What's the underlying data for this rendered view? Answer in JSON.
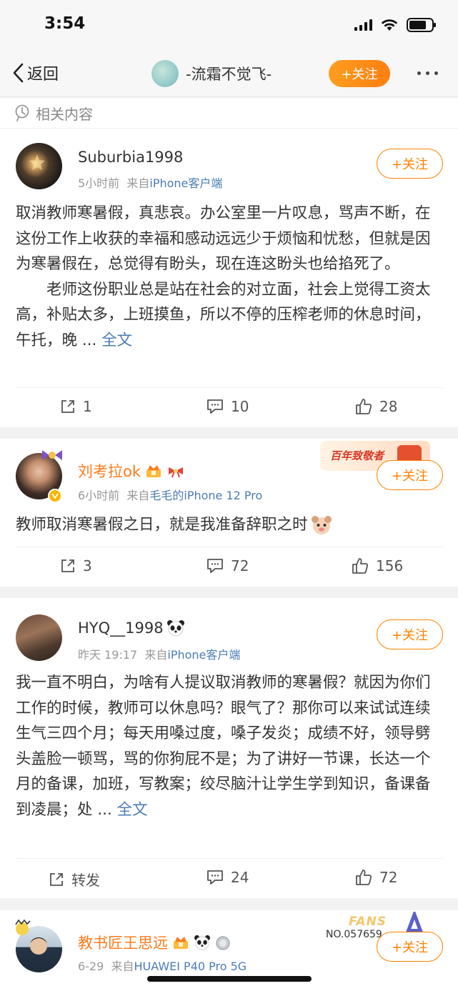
{
  "status": {
    "time": "3:54"
  },
  "nav": {
    "back_label": "返回",
    "title": "-流霜不觉飞-",
    "follow_label": "+关注"
  },
  "related": {
    "label": "相关内容"
  },
  "posts": [
    {
      "username": "Suburbia1998",
      "time": "5小时前",
      "from_label": "来自",
      "source": "iPhone客户端",
      "follow_label": "+关注",
      "content": "取消教师寒暑假，真悲哀。办公室里一片叹息，骂声不断，在这份工作上收获的幸福和感动远远少于烦恼和忧愁，但就是因为寒暑假在，总觉得有盼头，现在连这盼头也给掐死了。\n　　老师这份职业总是站在社会的对立面，社会上觉得工资太高，补贴太多，上班摸鱼，所以不停的压榨老师的休息时间，午托，晚 ... ",
      "more_label": "全文",
      "reposts": "1",
      "comments": "10",
      "likes": "28"
    },
    {
      "username": "刘考拉ok",
      "time": "6小时前",
      "from_label": "来自",
      "source": "毛毛的iPhone 12 Pro",
      "follow_label": "+关注",
      "banner_text": "百年致敬者",
      "content": "教师取消寒暑假之日，就是我准备辞职之时",
      "reposts": "3",
      "comments": "72",
      "likes": "156"
    },
    {
      "username": "HYQ__1998",
      "time": "昨天 19:17",
      "from_label": "来自",
      "source": "iPhone客户端",
      "follow_label": "+关注",
      "content": "我一直不明白，为啥有人提议取消教师的寒暑假？就因为你们工作的时候，教师可以休息吗？眼气了？那你可以来试试连续生气三四个月；每天用嗓过度，嗓子发炎；成绩不好，领导劈头盖脸一顿骂，骂的你狗屁不是；为了讲好一节课，长达一个月的备课，加班，写教案；绞尽脑汁让学生学到知识，备课备到凌晨；处 ... ",
      "more_label": "全文",
      "repost_label": "转发",
      "comments": "24",
      "likes": "72"
    },
    {
      "username": "教书匠王思远",
      "time": "6-29",
      "from_label": "来自",
      "source": "HUAWEI P40 Pro 5G",
      "follow_label": "+关注",
      "fans_label": "FANS",
      "fans_no": "NO.057659"
    }
  ],
  "colors": {
    "accent": "#ff8200",
    "link": "#4b7db5",
    "meta": "#999999"
  }
}
